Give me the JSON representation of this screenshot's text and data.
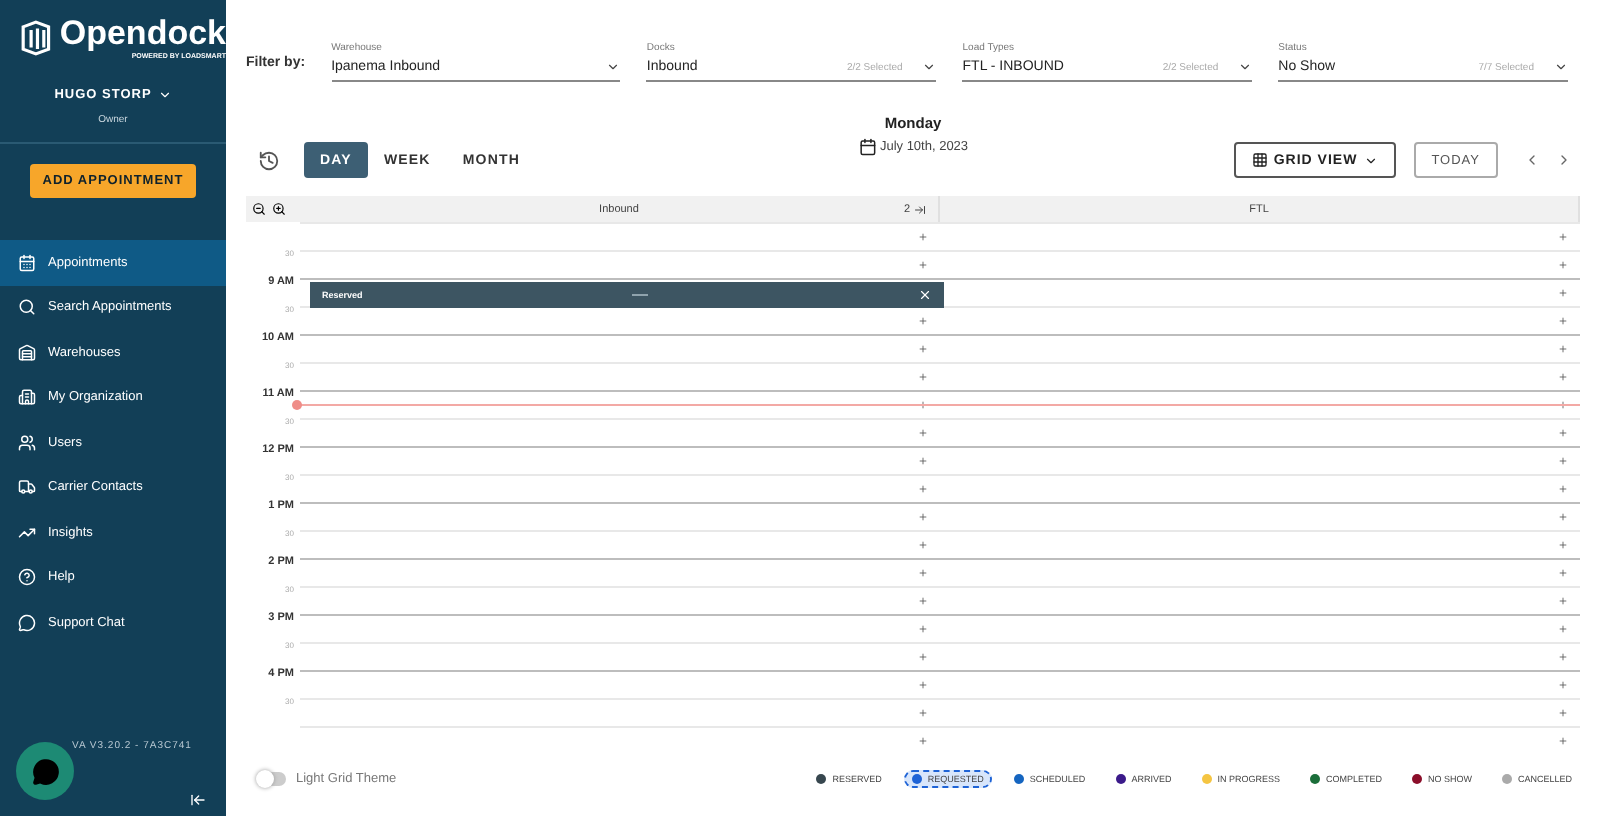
{
  "sidebar": {
    "logo": {
      "name": "Opendock",
      "tagline": "POWERED BY LOADSMART"
    },
    "user": {
      "name": "HUGO STORP",
      "role": "Owner"
    },
    "add_button": "ADD APPOINTMENT",
    "items": [
      {
        "label": "Appointments",
        "selected": true
      },
      {
        "label": "Search Appointments",
        "selected": false
      },
      {
        "label": "Warehouses",
        "selected": false
      },
      {
        "label": "My Organization",
        "selected": false
      },
      {
        "label": "Users",
        "selected": false
      },
      {
        "label": "Carrier Contacts",
        "selected": false
      },
      {
        "label": "Insights",
        "selected": false
      },
      {
        "label": "Help",
        "selected": false
      },
      {
        "label": "Support Chat",
        "selected": false
      }
    ],
    "version": "VA V3.20.2 - 7A3C741"
  },
  "filters": {
    "label": "Filter by:",
    "fields": [
      {
        "label": "Warehouse",
        "value": "Ipanema Inbound"
      },
      {
        "label": "Docks",
        "value": "Inbound",
        "count": "2/2 Selected"
      },
      {
        "label": "Load Types",
        "value": "FTL - INBOUND",
        "count": "2/2 Selected"
      },
      {
        "label": "Status",
        "value": "No Show",
        "count": "7/7 Selected"
      }
    ]
  },
  "toolbar": {
    "views": [
      {
        "label": "DAY",
        "selected": true
      },
      {
        "label": "WEEK",
        "selected": false
      },
      {
        "label": "MONTH",
        "selected": false
      }
    ],
    "day": "Monday",
    "date": "July 10th, 2023",
    "grid_view": "GRID VIEW",
    "today": "TODAY"
  },
  "grid": {
    "columns": [
      {
        "name": "Inbound",
        "count": "2"
      },
      {
        "name": "FTL"
      }
    ],
    "rows": [
      {
        "now": false
      },
      {
        "label": "30",
        "hour": false,
        "now": false
      },
      {
        "label": "9 AM",
        "hour": true,
        "now": false,
        "event": {
          "label": "Reserved"
        }
      },
      {
        "label": "30",
        "hour": false,
        "now": false
      },
      {
        "label": "10 AM",
        "hour": true,
        "now": false
      },
      {
        "label": "30",
        "hour": false,
        "now": false
      },
      {
        "label": "11 AM",
        "hour": true,
        "now": true
      },
      {
        "label": "30",
        "hour": false,
        "now": false
      },
      {
        "label": "12 PM",
        "hour": true,
        "now": false
      },
      {
        "label": "30",
        "hour": false,
        "now": false
      },
      {
        "label": "1 PM",
        "hour": true,
        "now": false
      },
      {
        "label": "30",
        "hour": false,
        "now": false
      },
      {
        "label": "2 PM",
        "hour": true,
        "now": false
      },
      {
        "label": "30",
        "hour": false,
        "now": false
      },
      {
        "label": "3 PM",
        "hour": true,
        "now": false
      },
      {
        "label": "30",
        "hour": false,
        "now": false
      },
      {
        "label": "4 PM",
        "hour": true,
        "now": false
      },
      {
        "label": "30",
        "hour": false,
        "now": false
      },
      {
        "now": false
      }
    ]
  },
  "footer": {
    "theme_toggle": {
      "label": "Light Grid Theme",
      "on": false
    },
    "legend": [
      {
        "label": "RESERVED",
        "color": "#37474f",
        "selected": false
      },
      {
        "label": "REQUESTED",
        "color": "#1e63d6",
        "selected": true
      },
      {
        "label": "SCHEDULED",
        "color": "#1565c0",
        "selected": false
      },
      {
        "label": "ARRIVED",
        "color": "#3b1a8a",
        "selected": false
      },
      {
        "label": "IN PROGRESS",
        "color": "#f5c542",
        "selected": false
      },
      {
        "label": "COMPLETED",
        "color": "#1b6e3a",
        "selected": false
      },
      {
        "label": "NO SHOW",
        "color": "#8b0e2a",
        "selected": false
      },
      {
        "label": "CANCELLED",
        "color": "#aaaaaa",
        "selected": false
      }
    ]
  }
}
